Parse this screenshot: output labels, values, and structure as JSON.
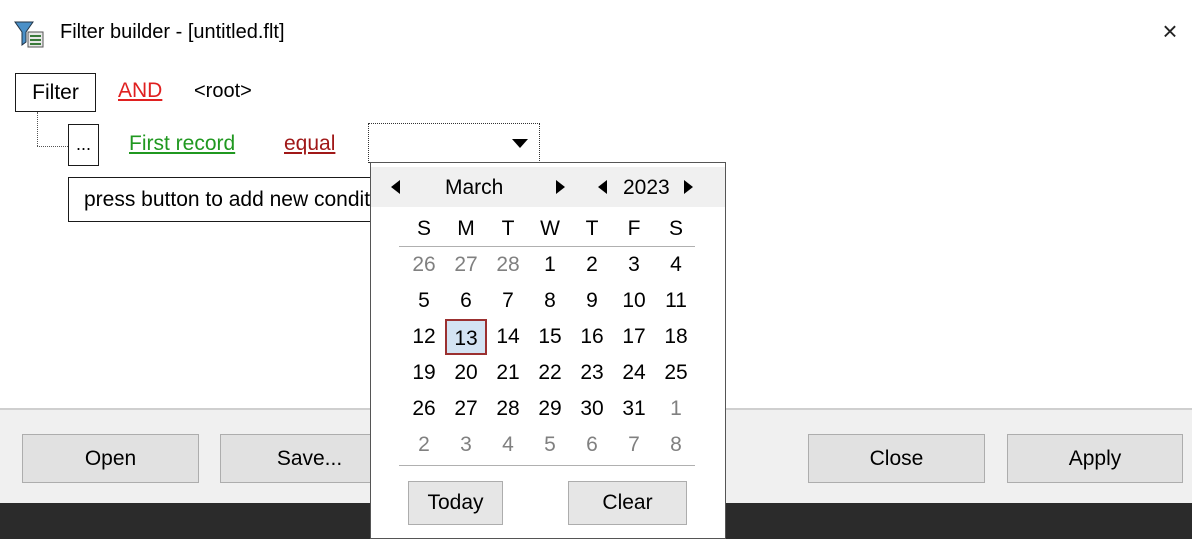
{
  "window": {
    "title": "Filter builder - [untitled.flt]",
    "close_glyph": "×"
  },
  "tree": {
    "filter_label": "Filter",
    "group_operator": "AND",
    "root_label": "<root>",
    "condition": {
      "menu_label": "...",
      "field": "First record",
      "operator": "equal",
      "value": ""
    },
    "add_condition_label": "press button to add new condition"
  },
  "buttons": {
    "open": "Open",
    "save": "Save...",
    "close": "Close",
    "apply": "Apply"
  },
  "calendar": {
    "month": "March",
    "year": "2023",
    "weekday_headers": [
      "S",
      "M",
      "T",
      "W",
      "T",
      "F",
      "S"
    ],
    "weeks": [
      [
        {
          "d": "26",
          "dim": true
        },
        {
          "d": "27",
          "dim": true
        },
        {
          "d": "28",
          "dim": true
        },
        {
          "d": "1"
        },
        {
          "d": "2"
        },
        {
          "d": "3"
        },
        {
          "d": "4"
        }
      ],
      [
        {
          "d": "5"
        },
        {
          "d": "6"
        },
        {
          "d": "7"
        },
        {
          "d": "8"
        },
        {
          "d": "9"
        },
        {
          "d": "10"
        },
        {
          "d": "11"
        }
      ],
      [
        {
          "d": "12"
        },
        {
          "d": "13",
          "today": true
        },
        {
          "d": "14"
        },
        {
          "d": "15"
        },
        {
          "d": "16"
        },
        {
          "d": "17"
        },
        {
          "d": "18"
        }
      ],
      [
        {
          "d": "19"
        },
        {
          "d": "20"
        },
        {
          "d": "21"
        },
        {
          "d": "22"
        },
        {
          "d": "23"
        },
        {
          "d": "24"
        },
        {
          "d": "25"
        }
      ],
      [
        {
          "d": "26"
        },
        {
          "d": "27"
        },
        {
          "d": "28"
        },
        {
          "d": "29"
        },
        {
          "d": "30"
        },
        {
          "d": "31"
        },
        {
          "d": "1",
          "dim": true
        }
      ],
      [
        {
          "d": "2",
          "dim": true
        },
        {
          "d": "3",
          "dim": true
        },
        {
          "d": "4",
          "dim": true
        },
        {
          "d": "5",
          "dim": true
        },
        {
          "d": "6",
          "dim": true
        },
        {
          "d": "7",
          "dim": true
        },
        {
          "d": "8",
          "dim": true
        }
      ]
    ],
    "today_button": "Today",
    "clear_button": "Clear"
  },
  "colors": {
    "and_link": "#e02020",
    "field_link": "#209820",
    "operator_link": "#a01818",
    "today_border": "#9b3030",
    "today_fill": "#d3e3f3"
  }
}
